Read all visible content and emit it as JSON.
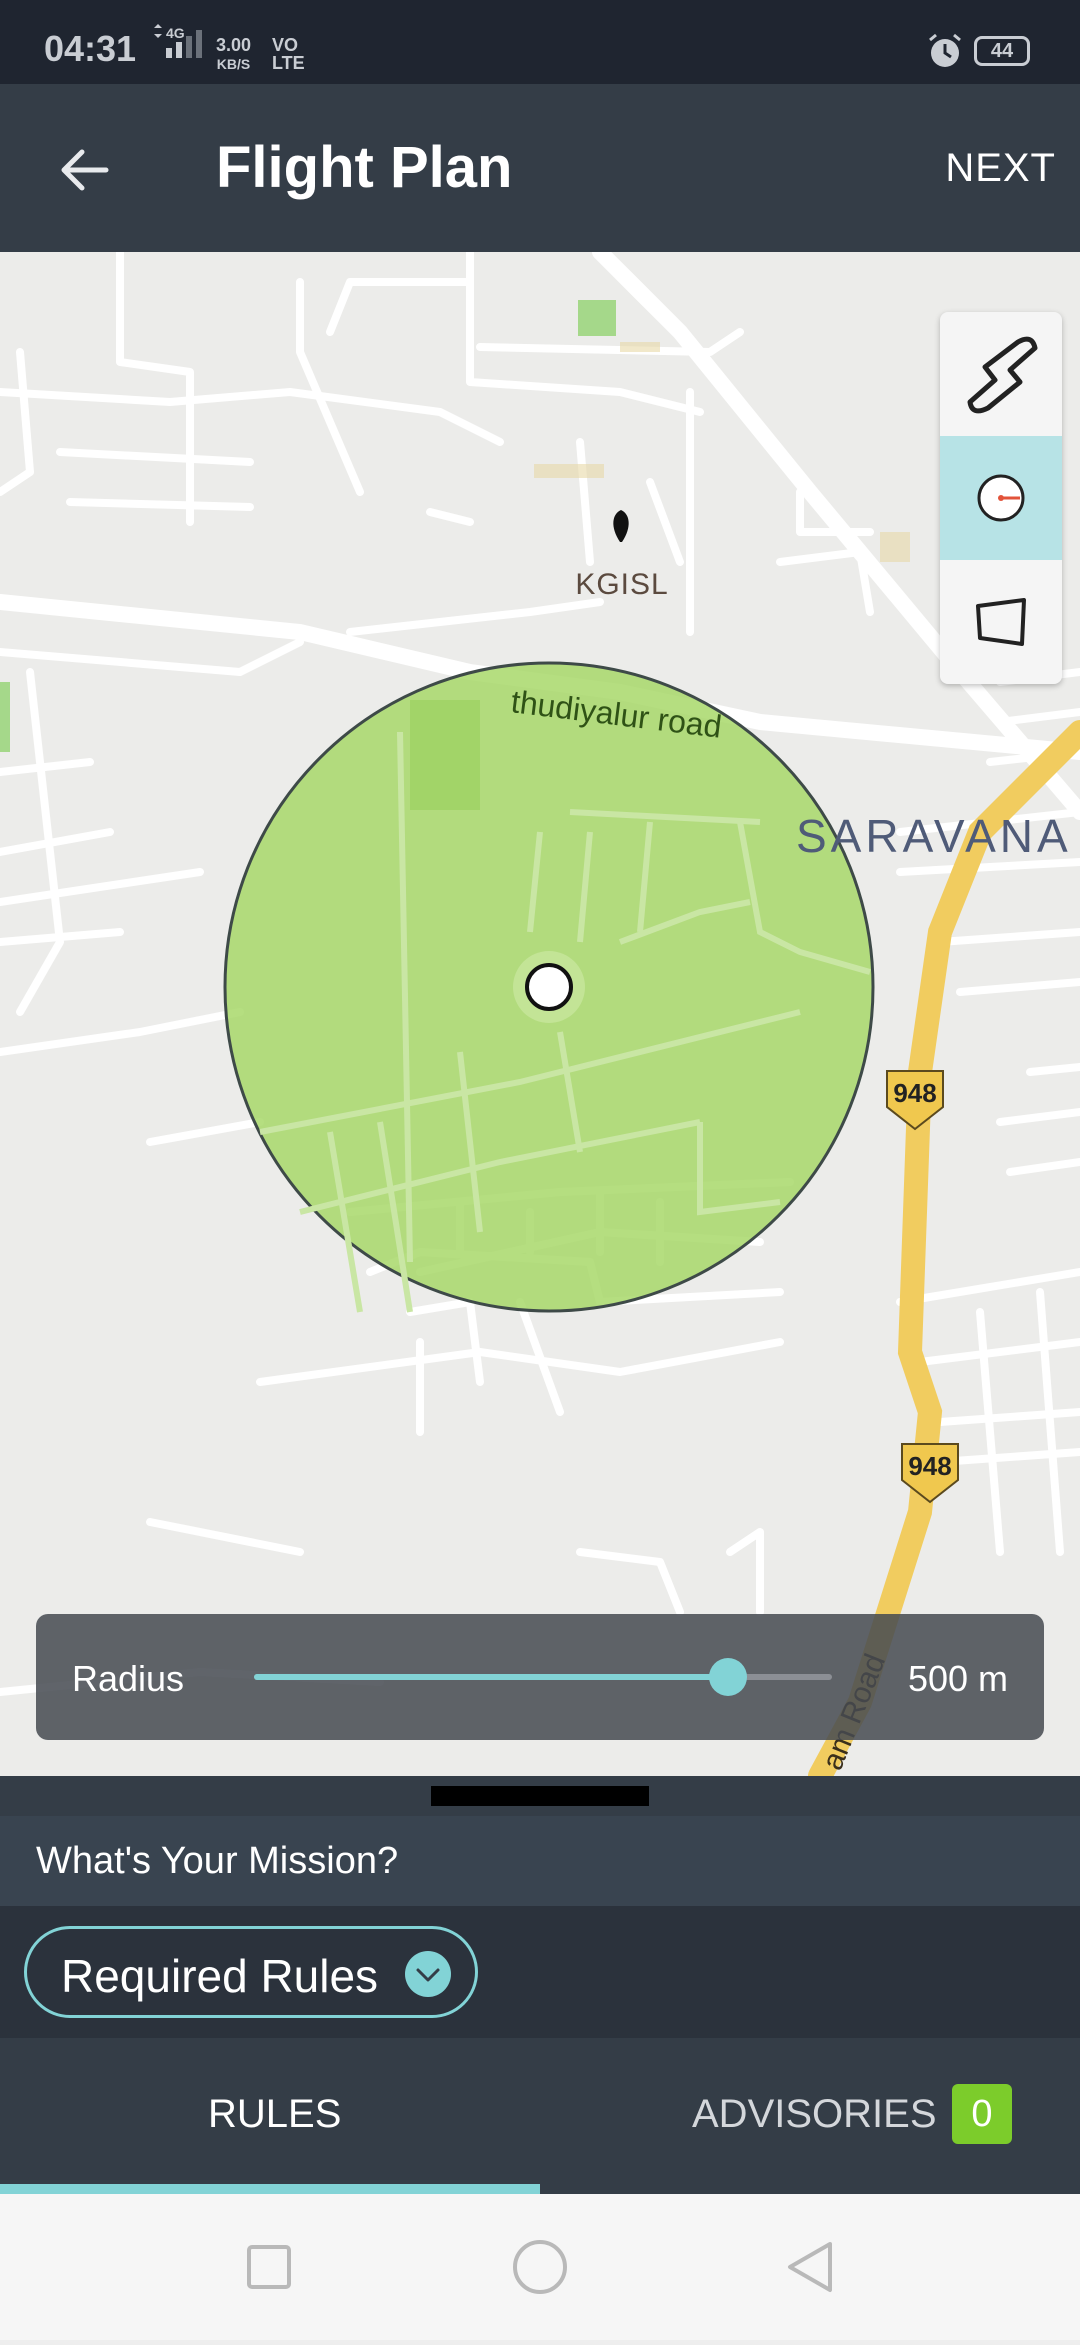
{
  "status_bar": {
    "time": "04:31",
    "network": "4G",
    "speed": "3.00",
    "speed_unit": "KB/S",
    "volte_top": "VO",
    "volte_bottom": "LTE",
    "battery": "44"
  },
  "header": {
    "title": "Flight Plan",
    "next_label": "NEXT",
    "back_icon": "arrow-left-icon"
  },
  "map": {
    "poi_label": "KGISL",
    "road_label": "thudiyalur road",
    "area_label": "SARAVANA",
    "highway_number": "948",
    "road_label_2": "am Road",
    "zone_color": "#a8d86a",
    "tools": [
      {
        "name": "path-tool",
        "icon": "path-icon",
        "active": false
      },
      {
        "name": "circle-tool",
        "icon": "circle-radius-icon",
        "active": true
      },
      {
        "name": "polygon-tool",
        "icon": "polygon-icon",
        "active": false
      }
    ]
  },
  "radius": {
    "label": "Radius",
    "value_text": "500 m",
    "slider_fraction": 0.82
  },
  "sheet": {
    "mission_prompt": "What's Your Mission?",
    "rules_pill_label": "Required Rules"
  },
  "tabs": {
    "rules_label": "RULES",
    "advisories_label": "ADVISORIES",
    "advisories_count": "0",
    "accent_color": "#82d3d6",
    "badge_color": "#7ccc2b"
  }
}
